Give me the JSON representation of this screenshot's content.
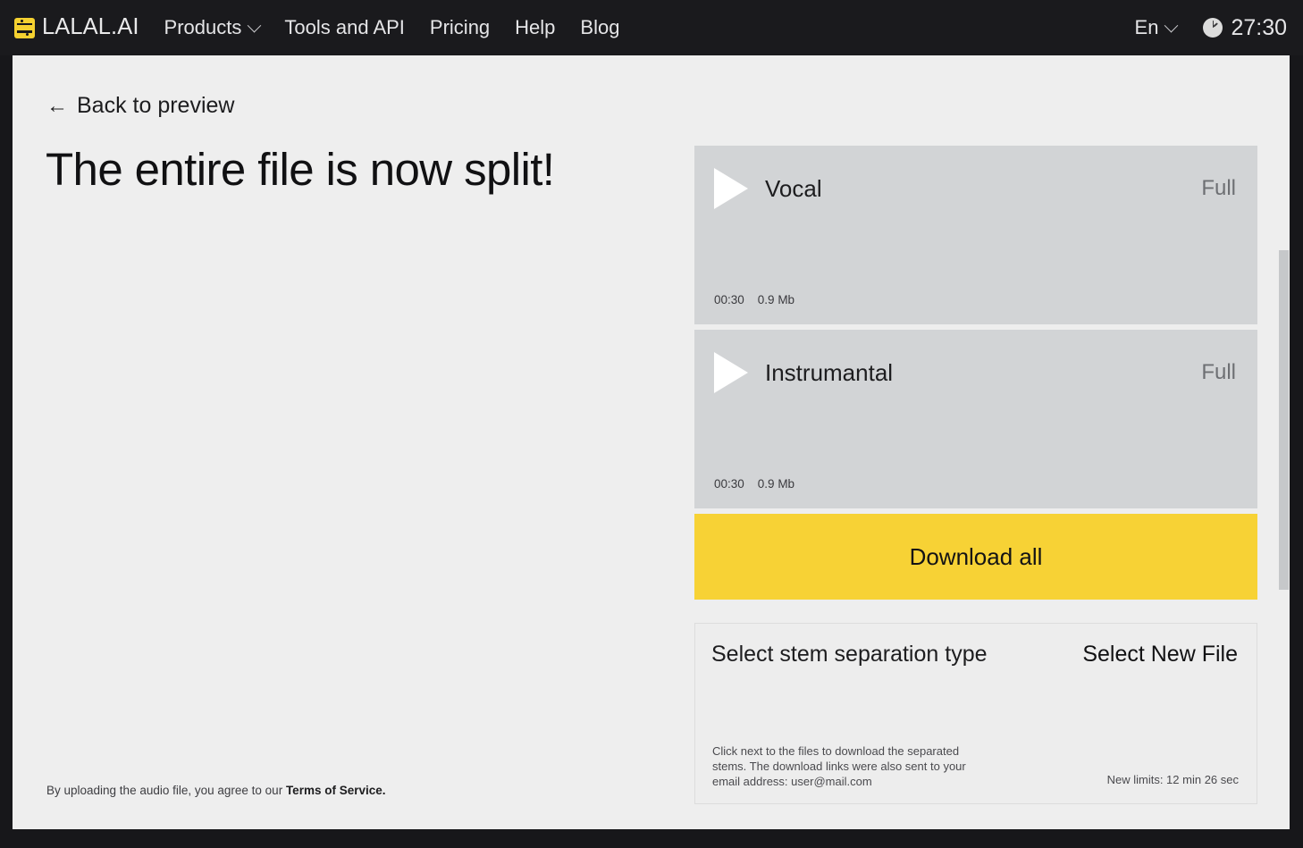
{
  "header": {
    "brand": "LALAL.AI",
    "logo_icon": "lalal-logo-icon",
    "nav": [
      {
        "label": "Products",
        "has_chevron": true
      },
      {
        "label": "Tools and API",
        "has_chevron": false
      },
      {
        "label": "Pricing",
        "has_chevron": false
      },
      {
        "label": "Help",
        "has_chevron": false
      },
      {
        "label": "Blog",
        "has_chevron": false
      }
    ],
    "language": "En",
    "timer": "27:30",
    "clock_icon": "clock-icon",
    "background_color": "#1a1a1d"
  },
  "main": {
    "back_link": "Back to preview",
    "back_arrow": "←",
    "headline": "The entire file is now split!",
    "terms_prefix": "By uploading the audio file, you agree to our ",
    "terms_link": "Terms of Service."
  },
  "stems": [
    {
      "name": "Vocal",
      "quality": "Full",
      "duration": "00:30",
      "size": "0.9 Mb",
      "play_icon": "play-icon"
    },
    {
      "name": "Instrumantal",
      "quality": "Full",
      "duration": "00:30",
      "size": "0.9 Mb",
      "play_icon": "play-icon"
    }
  ],
  "download": {
    "label": "Download all",
    "accent_color": "#f7d235"
  },
  "bottom_panel": {
    "select_type": "Select stem separation type",
    "select_new_file": "Select New File",
    "note": "Click  next to the files to download the separated stems. The download links were also sent to your email address: user@mail.com",
    "limits": "New limits: 12 min 26 sec"
  }
}
